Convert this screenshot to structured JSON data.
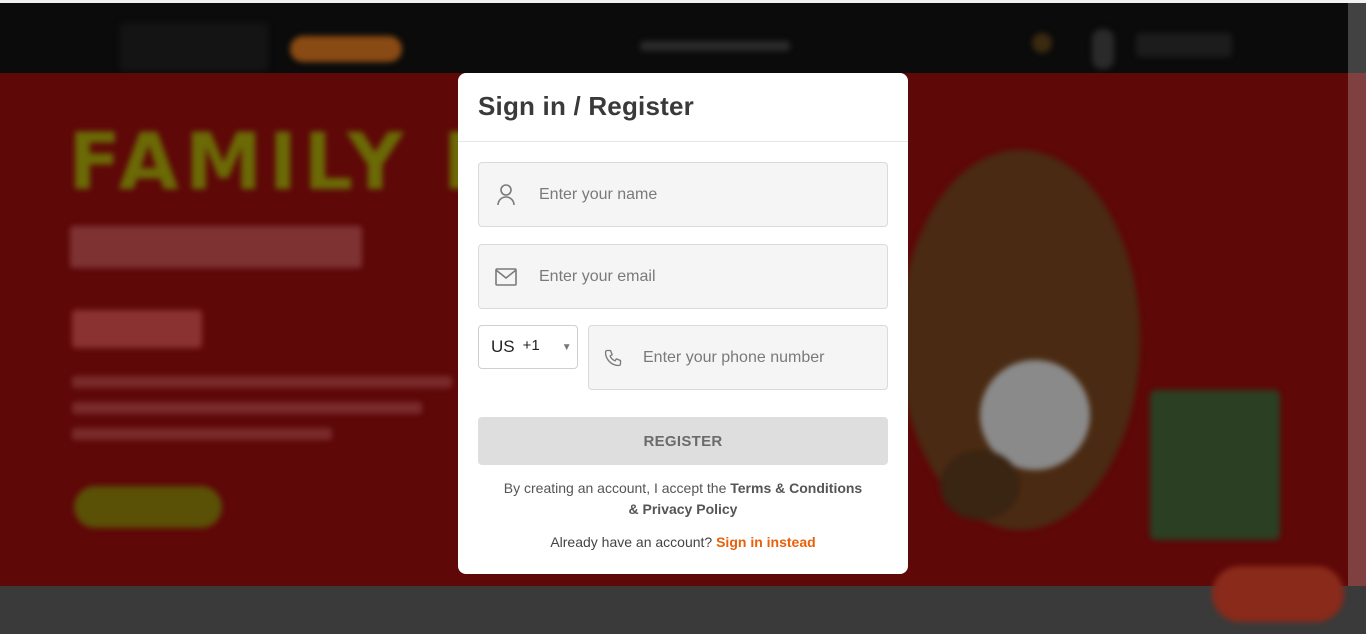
{
  "background": {
    "hero_headline": "FAMILY FE",
    "colors": {
      "header": "#0b0b0b",
      "hero": "#5e0808",
      "accent": "#e8600a"
    }
  },
  "modal": {
    "title": "Sign in / Register",
    "name_field": {
      "placeholder": "Enter your name",
      "value": "",
      "icon": "user-icon"
    },
    "email_field": {
      "placeholder": "Enter your email",
      "value": "",
      "icon": "mail-icon"
    },
    "country_select": {
      "country": "US",
      "dial_code": "+1",
      "icon": "caret-down-icon"
    },
    "phone_field": {
      "placeholder": "Enter your phone number",
      "value": "",
      "icon": "phone-icon"
    },
    "register_label": "REGISTER",
    "terms_prefix": "By creating an account, I accept the ",
    "terms_link": "Terms & Conditions",
    "privacy_link": "& Privacy Policy",
    "signin_prompt": "Already have an account? ",
    "signin_link": "Sign in instead"
  }
}
